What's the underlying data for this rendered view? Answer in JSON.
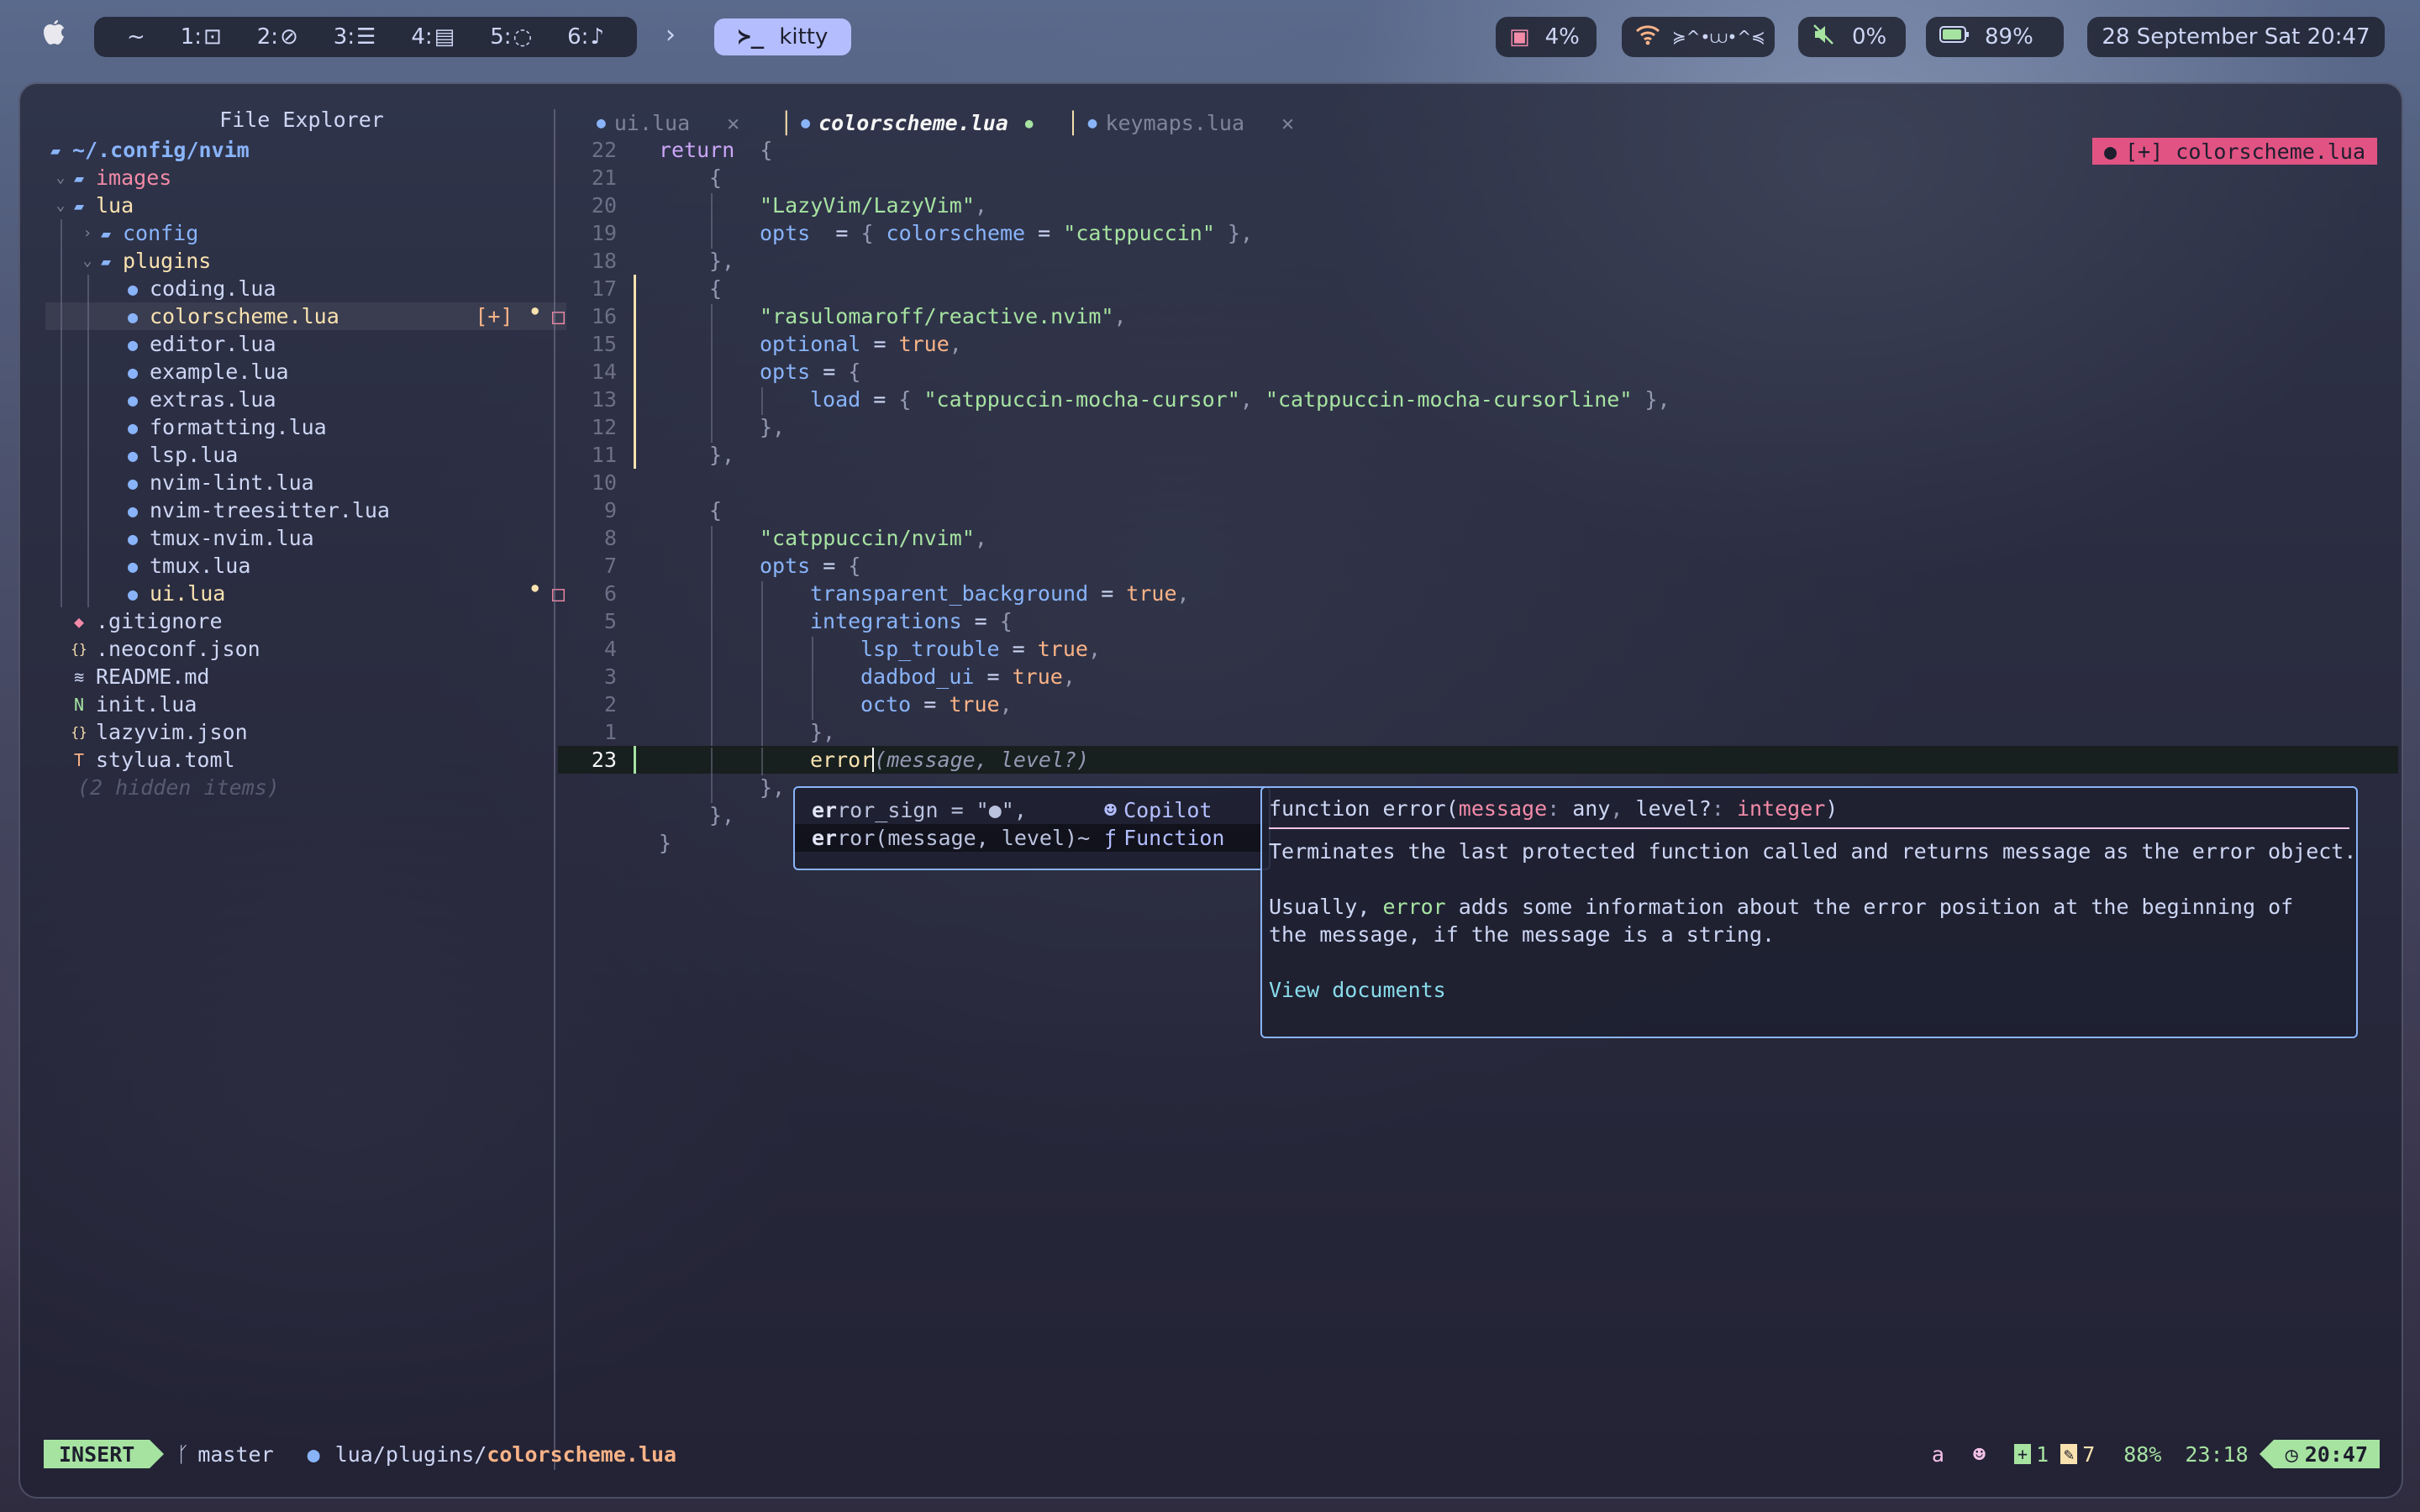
{
  "menubar": {
    "workspaces": [
      {
        "label": "~",
        "icon": ""
      },
      {
        "label": "1:",
        "icon": "terminal-icon"
      },
      {
        "label": "2:",
        "icon": "compass-icon"
      },
      {
        "label": "3:",
        "icon": "list-icon"
      },
      {
        "label": "4:",
        "icon": "document-icon"
      },
      {
        "label": "5:",
        "icon": "chat-bubble-icon"
      },
      {
        "label": "6:",
        "icon": "music-note-icon"
      }
    ],
    "app": {
      "label": "kitty",
      "icon": "terminal-prompt-icon"
    },
    "cpu": "4%",
    "wifi": "≽^•⩊•^≼",
    "volume": "0%",
    "battery": "89%",
    "datetime": "28 September Sat 20:47"
  },
  "explorer": {
    "title": "File Explorer",
    "root": "~/.config/nvim",
    "items": [
      {
        "depth": 1,
        "chev": "v",
        "icon": "folder-open-icon",
        "label": "images",
        "color": "#f38ba8"
      },
      {
        "depth": 1,
        "chev": "v",
        "icon": "folder-open-icon",
        "label": "lua",
        "color": "#f9e2af"
      },
      {
        "depth": 2,
        "chev": ">",
        "icon": "folder-icon",
        "label": "config",
        "color": "#89b4fa"
      },
      {
        "depth": 2,
        "chev": "v",
        "icon": "folder-open-icon",
        "label": "plugins",
        "color": "#f9e2af"
      },
      {
        "depth": 3,
        "icon": "lua-icon",
        "label": "coding.lua"
      },
      {
        "depth": 3,
        "icon": "lua-icon",
        "label": "colorscheme.lua",
        "color": "#f9e2af",
        "selected": true,
        "mod": "[+]",
        "dot": "●",
        "box": "□"
      },
      {
        "depth": 3,
        "icon": "lua-icon",
        "label": "editor.lua"
      },
      {
        "depth": 3,
        "icon": "lua-icon",
        "label": "example.lua"
      },
      {
        "depth": 3,
        "icon": "lua-icon",
        "label": "extras.lua"
      },
      {
        "depth": 3,
        "icon": "lua-icon",
        "label": "formatting.lua"
      },
      {
        "depth": 3,
        "icon": "lua-icon",
        "label": "lsp.lua"
      },
      {
        "depth": 3,
        "icon": "lua-icon",
        "label": "nvim-lint.lua"
      },
      {
        "depth": 3,
        "icon": "lua-icon",
        "label": "nvim-treesitter.lua"
      },
      {
        "depth": 3,
        "icon": "lua-icon",
        "label": "tmux-nvim.lua"
      },
      {
        "depth": 3,
        "icon": "lua-icon",
        "label": "tmux.lua"
      },
      {
        "depth": 3,
        "icon": "lua-icon",
        "label": "ui.lua",
        "color": "#f9e2af",
        "dot": "●",
        "box": "□"
      },
      {
        "depth": 1,
        "icon": "git-icon",
        "label": ".gitignore"
      },
      {
        "depth": 1,
        "icon": "json-icon",
        "label": ".neoconf.json"
      },
      {
        "depth": 1,
        "icon": "readme-icon",
        "label": "README.md"
      },
      {
        "depth": 1,
        "icon": "neovim-icon",
        "label": "init.lua"
      },
      {
        "depth": 1,
        "icon": "json-icon",
        "label": "lazyvim.json"
      },
      {
        "depth": 1,
        "icon": "toml-icon",
        "label": "stylua.toml"
      }
    ],
    "hidden": "(2 hidden items)"
  },
  "tabs": [
    {
      "label": "ui.lua",
      "close": "✕",
      "active": false
    },
    {
      "label": "colorscheme.lua",
      "modified": "●",
      "active": true
    },
    {
      "label": "keymaps.lua",
      "close": "✕",
      "active": false
    }
  ],
  "file_badge": "[+] colorscheme.lua",
  "code": [
    {
      "n": "22",
      "segs": [
        [
          "kw",
          "return"
        ],
        [
          "",
          "  "
        ],
        [
          "punct",
          "{"
        ]
      ],
      "indent": 0
    },
    {
      "n": "21",
      "segs": [
        [
          "punct",
          "{"
        ]
      ],
      "indent": 1
    },
    {
      "n": "20",
      "segs": [
        [
          "str",
          "\"LazyVim/LazyVim\""
        ],
        [
          "punct",
          ","
        ]
      ],
      "indent": 2
    },
    {
      "n": "19",
      "segs": [
        [
          "prop",
          "opts"
        ],
        [
          "",
          "  = "
        ],
        [
          "punct",
          "{ "
        ],
        [
          "prop",
          "colorscheme"
        ],
        [
          "",
          " = "
        ],
        [
          "str",
          "\"catppuccin\""
        ],
        [
          "punct",
          " },"
        ]
      ],
      "indent": 2
    },
    {
      "n": "18",
      "segs": [
        [
          "punct",
          "},"
        ]
      ],
      "indent": 1
    },
    {
      "n": "17",
      "segs": [
        [
          "punct",
          "{"
        ]
      ],
      "indent": 1,
      "sign": "#f9e2af"
    },
    {
      "n": "16",
      "segs": [
        [
          "str",
          "\"rasulomaroff/reactive.nvim\""
        ],
        [
          "punct",
          ","
        ]
      ],
      "indent": 2,
      "sign": "#f9e2af"
    },
    {
      "n": "15",
      "segs": [
        [
          "prop",
          "optional"
        ],
        [
          "",
          " = "
        ],
        [
          "num",
          "true"
        ],
        [
          "punct",
          ","
        ]
      ],
      "indent": 2,
      "sign": "#f9e2af"
    },
    {
      "n": "14",
      "segs": [
        [
          "prop",
          "opts"
        ],
        [
          "",
          " = "
        ],
        [
          "punct",
          "{"
        ]
      ],
      "indent": 2,
      "sign": "#f9e2af"
    },
    {
      "n": "13",
      "segs": [
        [
          "prop",
          "load"
        ],
        [
          "",
          " = "
        ],
        [
          "punct",
          "{ "
        ],
        [
          "str",
          "\"catppuccin-mocha-cursor\""
        ],
        [
          "punct",
          ", "
        ],
        [
          "str",
          "\"catppuccin-mocha-cursorline\""
        ],
        [
          "punct",
          " },"
        ]
      ],
      "indent": 3,
      "sign": "#f9e2af"
    },
    {
      "n": "12",
      "segs": [
        [
          "punct",
          "},"
        ]
      ],
      "indent": 2,
      "sign": "#f9e2af"
    },
    {
      "n": "11",
      "segs": [
        [
          "punct",
          "},"
        ]
      ],
      "indent": 1,
      "sign": "#f9e2af"
    },
    {
      "n": "10",
      "segs": [],
      "indent": 0
    },
    {
      "n": "9",
      "segs": [
        [
          "punct",
          "{"
        ]
      ],
      "indent": 1
    },
    {
      "n": "8",
      "segs": [
        [
          "str",
          "\"catppuccin/nvim\""
        ],
        [
          "punct",
          ","
        ]
      ],
      "indent": 2
    },
    {
      "n": "7",
      "segs": [
        [
          "prop",
          "opts"
        ],
        [
          "",
          " = "
        ],
        [
          "punct",
          "{"
        ]
      ],
      "indent": 2
    },
    {
      "n": "6",
      "segs": [
        [
          "prop",
          "transparent_background"
        ],
        [
          "",
          " = "
        ],
        [
          "num",
          "true"
        ],
        [
          "punct",
          ","
        ]
      ],
      "indent": 3
    },
    {
      "n": "5",
      "segs": [
        [
          "prop",
          "integrations"
        ],
        [
          "",
          " = "
        ],
        [
          "punct",
          "{"
        ]
      ],
      "indent": 3
    },
    {
      "n": "4",
      "segs": [
        [
          "prop",
          "lsp_trouble"
        ],
        [
          "",
          " = "
        ],
        [
          "num",
          "true"
        ],
        [
          "punct",
          ","
        ]
      ],
      "indent": 4
    },
    {
      "n": "3",
      "segs": [
        [
          "prop",
          "dadbod_ui"
        ],
        [
          "",
          " = "
        ],
        [
          "num",
          "true"
        ],
        [
          "punct",
          ","
        ]
      ],
      "indent": 4
    },
    {
      "n": "2",
      "segs": [
        [
          "prop",
          "octo"
        ],
        [
          "",
          " = "
        ],
        [
          "num",
          "true"
        ],
        [
          "punct",
          ","
        ]
      ],
      "indent": 4
    },
    {
      "n": "1",
      "segs": [
        [
          "punct",
          "},"
        ]
      ],
      "indent": 3
    },
    {
      "n": "23",
      "segs": [
        [
          "fn",
          "error"
        ],
        [
          "hint",
          "(message, level?)"
        ]
      ],
      "indent": 3,
      "current": true
    },
    {
      "n": "",
      "segs": [
        [
          "punct",
          "},"
        ]
      ],
      "indent": 2
    },
    {
      "n": "",
      "segs": [
        [
          "punct",
          "},"
        ]
      ],
      "indent": 1
    },
    {
      "n": "",
      "segs": [
        [
          "punct",
          "}"
        ]
      ],
      "indent": 0
    }
  ],
  "completion": {
    "items": [
      {
        "match": "er",
        "rest": "ror_sign = \"●\",",
        "kind": "Copilot",
        "kind_icon": "copilot-icon"
      },
      {
        "match": "er",
        "rest": "ror(message, level)~",
        "kind": "Function",
        "kind_icon": "function-icon",
        "selected": true
      }
    ]
  },
  "doc": {
    "signature": "function error(message: any, level?: integer)",
    "line1": "Terminates the last protected function called and returns message as the error object.",
    "line2": "Usually, error adds some information about the error position at the beginning of",
    "line3": "the message, if the message is a string.",
    "link": "View documents"
  },
  "status": {
    "mode": "INSERT",
    "branch": "master",
    "path_dir": "lua/plugins/",
    "path_file": "colorscheme.lua",
    "register": "a",
    "added": "1",
    "changed": "7",
    "percent": "88%",
    "position": "23:18",
    "time": "20:47"
  },
  "colors": {
    "accent": "#b4befe",
    "mode_green": "#a6e3a1",
    "badge_pink": "#e05383"
  }
}
